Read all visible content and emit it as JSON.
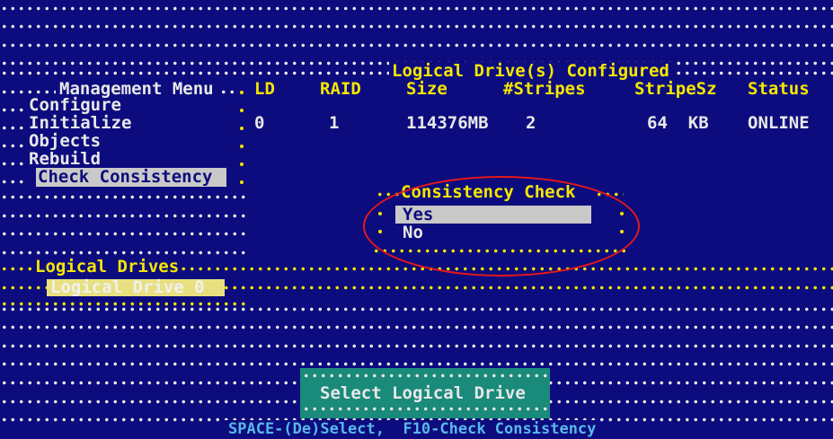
{
  "header": {
    "title": "Logical Drive(s) Configured"
  },
  "menu": {
    "title": "Management Menu",
    "items": [
      {
        "label": "Configure"
      },
      {
        "label": "Initialize"
      },
      {
        "label": "Objects"
      },
      {
        "label": "Rebuild"
      },
      {
        "label": "Check Consistency",
        "selected": true
      }
    ]
  },
  "table": {
    "columns": [
      "LD",
      "RAID",
      "Size",
      "#Stripes",
      "StripeSz",
      "Status"
    ],
    "rows": [
      {
        "ld": "0",
        "raid": "1",
        "size": "114376MB",
        "stripes": "2",
        "stripe_size": "64  KB",
        "status": "ONLINE"
      }
    ]
  },
  "logical_drives": {
    "title": "Logical Drives",
    "items": [
      {
        "label": "Logical Drive 0",
        "selected": true
      }
    ]
  },
  "consistency_popup": {
    "title": "Consistency Check",
    "options": [
      {
        "label": "Yes",
        "selected": true
      },
      {
        "label": "No"
      }
    ]
  },
  "footer": {
    "select_button": "Select Logical Drive",
    "hint": "SPACE-(De)Select,  F10-Check Consistency"
  },
  "colors": {
    "background": "#0c0c7e",
    "text": "#e8e8e8",
    "yellow": "#f5e600",
    "highlight": "#c9c9c9",
    "button_bg": "#1a8a7a",
    "annotation_red": "#e81818"
  }
}
